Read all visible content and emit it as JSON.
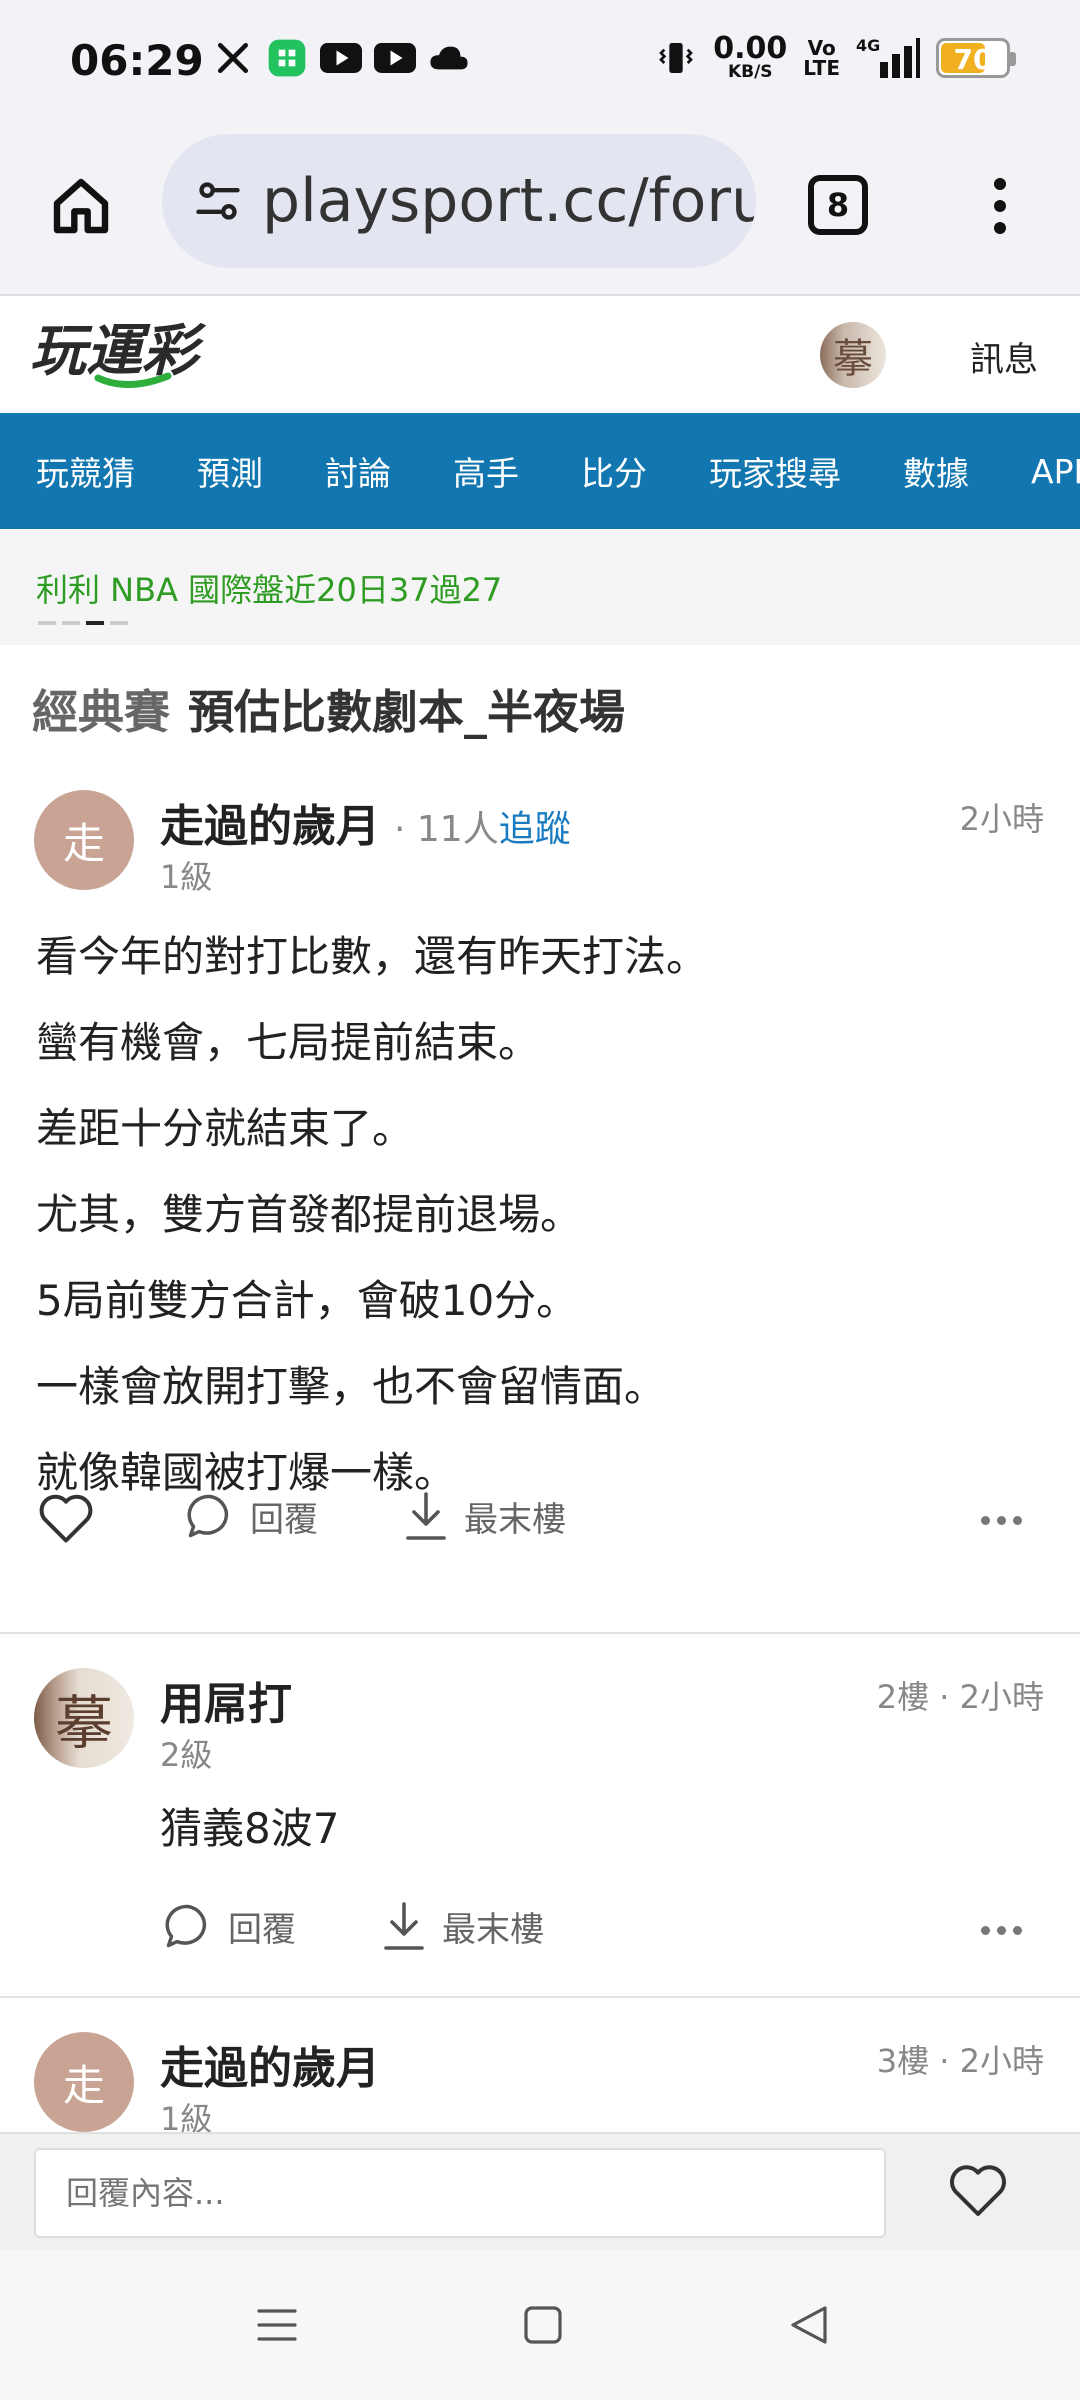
{
  "status_bar": {
    "time": "06:29",
    "net_speed_value": "0.00",
    "net_speed_unit": "KB/S",
    "volte_top": "Vo",
    "volte_bottom": "LTE",
    "network": "4G",
    "battery_level": "70",
    "battery_fraction": 0.7,
    "battery_color": "#f0b020",
    "notification_icons": [
      "x-icon",
      "line-app-icon",
      "youtube-icon",
      "youtube-icon",
      "cloud-icon"
    ]
  },
  "browser": {
    "url": "playsport.cc/foru",
    "tab_count": "8"
  },
  "site": {
    "logo_text": "玩運彩",
    "header_link": "訊息",
    "accent_color": "#1277b0",
    "nav": [
      "玩競猜",
      "預測",
      "討論",
      "高手",
      "比分",
      "玩家搜尋",
      "數據",
      "APP"
    ],
    "ticker": "利利 NBA 國際盤近20日37過27"
  },
  "thread": {
    "category": "經典賽",
    "title": "預估比數劇本_半夜場"
  },
  "posts": [
    {
      "avatar_text": "走",
      "author": "走過的歲月",
      "followers": "· 11人",
      "follow_label": "追蹤",
      "level": "1級",
      "time": "2小時",
      "body": [
        "看今年的對打比數，還有昨天打法。",
        "蠻有機會，七局提前結束。",
        "差距十分就結束了。",
        "尤其，雙方首發都提前退場。",
        "5局前雙方合計，會破10分。",
        "一樣會放開打擊，也不會留情面。",
        "就像韓國被打爆一樣。"
      ],
      "reply_label": "回覆",
      "last_floor_label": "最末樓"
    },
    {
      "avatar_text": "摹",
      "author": "用屌打",
      "level": "2級",
      "time": "2樓 · 2小時",
      "body": [
        "猜義8波7"
      ],
      "reply_label": "回覆",
      "last_floor_label": "最末樓"
    },
    {
      "avatar_text": "走",
      "author": "走過的歲月",
      "level": "1級",
      "time": "3樓 · 2小時"
    }
  ],
  "reply_bar": {
    "placeholder": "回覆內容..."
  },
  "header_avatar_text": "摹"
}
